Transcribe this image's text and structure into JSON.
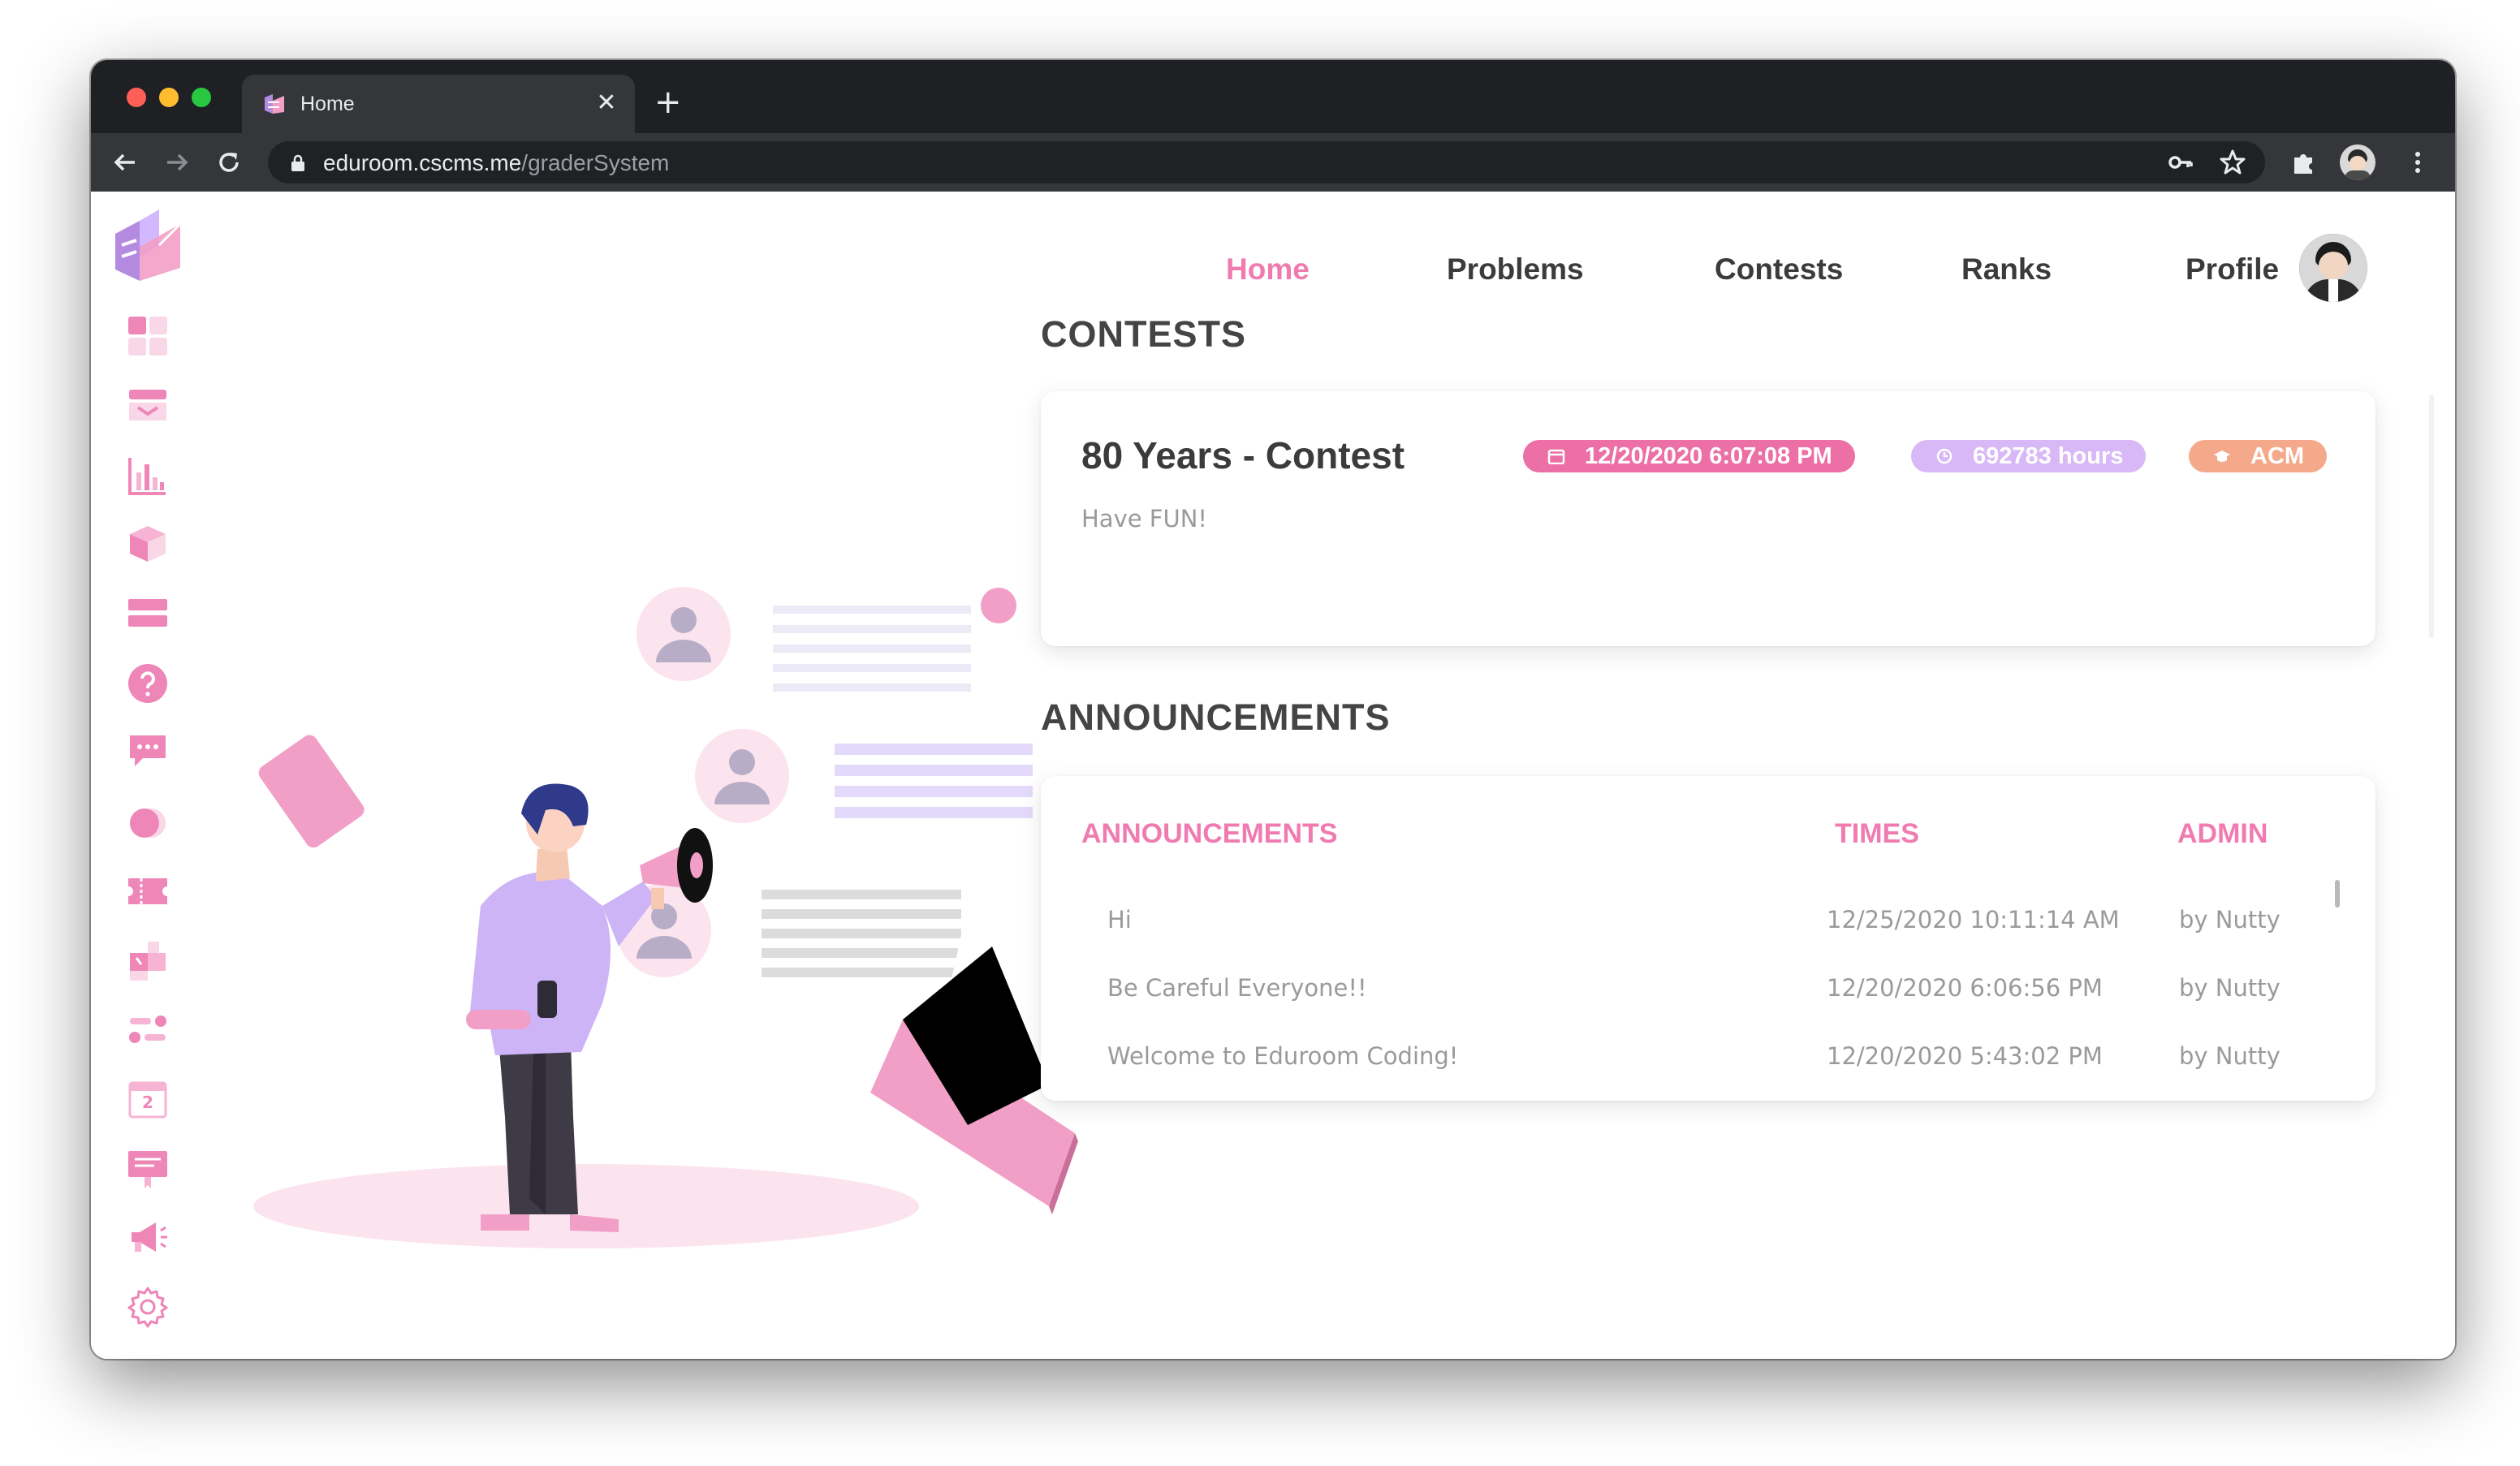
{
  "browser": {
    "tab_title": "Home",
    "url_host": "eduroom.cscms.me",
    "url_path": "/graderSystem"
  },
  "nav": {
    "home": "Home",
    "problems": "Problems",
    "contests": "Contests",
    "ranks": "Ranks",
    "profile": "Profile"
  },
  "sidebar": {
    "items": [
      "dashboard-icon",
      "inbox-icon",
      "chart-icon",
      "package-icon",
      "list-icon",
      "help-icon",
      "chat-icon",
      "toggle-icon",
      "ticket-icon",
      "puzzle-icon",
      "flow-icon",
      "calendar-icon",
      "certificate-icon",
      "megaphone-icon",
      "settings-icon"
    ],
    "calendar_day": "2"
  },
  "contests_section": {
    "title": "CONTESTS",
    "contest": {
      "name": "80 Years - Contest",
      "description": "Have FUN!",
      "date_badge": "12/20/2020 6:07:08 PM",
      "duration_badge": "692783 hours",
      "type_badge": "ACM"
    }
  },
  "announcements_section": {
    "title": "ANNOUNCEMENTS",
    "headers": {
      "announcement": "ANNOUNCEMENTS",
      "times": "TIMES",
      "admin": "ADMIN"
    },
    "rows": [
      {
        "text": "Hi",
        "time": "12/25/2020 10:11:14 AM",
        "admin": "by Nutty"
      },
      {
        "text": "Be Careful Everyone!!",
        "time": "12/20/2020 6:06:56 PM",
        "admin": "by Nutty"
      },
      {
        "text": "Welcome to Eduroom Coding!",
        "time": "12/20/2020 5:43:02 PM",
        "admin": "by Nutty"
      }
    ]
  },
  "colors": {
    "accent_pink": "#f07bb1",
    "badge_pink": "#ec6fa5",
    "badge_lavender": "#d8b8f7",
    "badge_orange": "#f4a98a",
    "illustration_purple": "#cdb4f7"
  }
}
